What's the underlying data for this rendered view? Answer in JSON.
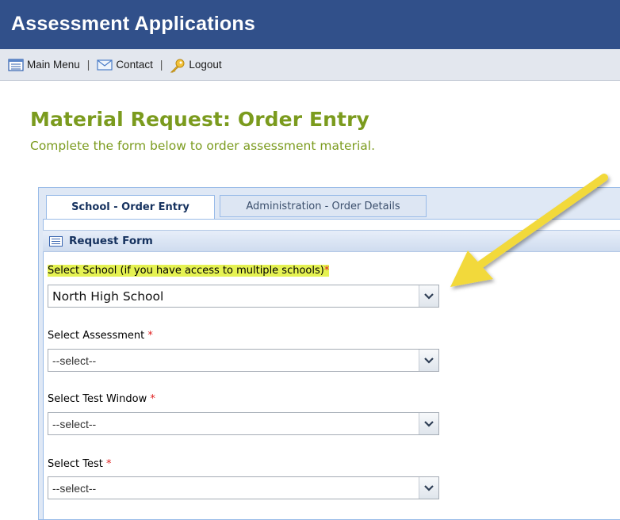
{
  "app": {
    "title": "Assessment Applications"
  },
  "toolbar": {
    "main_menu": "Main Menu",
    "contact": "Contact",
    "logout": "Logout",
    "separator": "|"
  },
  "page": {
    "title": "Material Request: Order Entry",
    "subtitle": "Complete the form below to order assessment material."
  },
  "tabs": [
    {
      "label": "School - Order Entry",
      "active": true
    },
    {
      "label": "Administration - Order Details",
      "active": false
    }
  ],
  "form": {
    "header": "Request Form",
    "required_mark": "*",
    "fields": [
      {
        "label": "Select School (if you have access to multiple schools)",
        "value": "North High School"
      },
      {
        "label": "Select Assessment",
        "value": "--select--"
      },
      {
        "label": "Select Test Window",
        "value": "--select--"
      },
      {
        "label": "Select Test",
        "value": "--select--"
      }
    ]
  },
  "colors": {
    "header_bg": "#31508a",
    "title_green": "#7b9b1e",
    "highlight": "#e5f252",
    "arrow": "#f2d93a"
  },
  "icons": [
    "list-icon",
    "envelope-icon",
    "key-icon",
    "form-icon",
    "chevron-down-icon",
    "arrow-annotation"
  ]
}
